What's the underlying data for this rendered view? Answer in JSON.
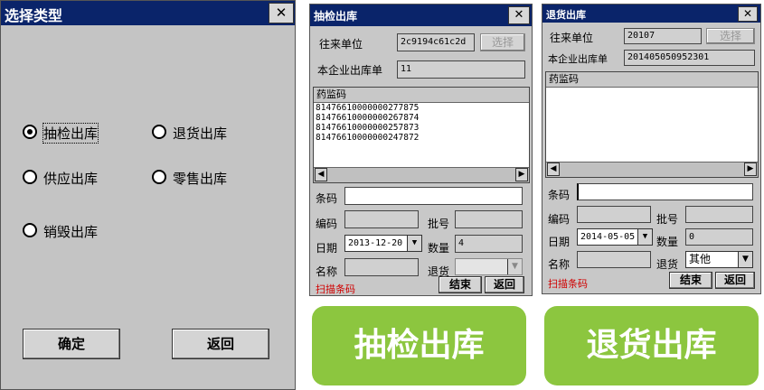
{
  "colors": {
    "title_bar": "#0a246a",
    "panel_bg": "#c8c8c8",
    "green_label": "#8cc63f",
    "scan_text": "#d00000"
  },
  "select_type": {
    "title": "选择类型",
    "close": "✕",
    "options": [
      {
        "label": "抽检出库",
        "selected": true
      },
      {
        "label": "退货出库",
        "selected": false
      },
      {
        "label": "供应出库",
        "selected": false
      },
      {
        "label": "零售出库",
        "selected": false
      },
      {
        "label": "销毁出库",
        "selected": false
      }
    ],
    "ok_label": "确定",
    "back_label": "返回"
  },
  "inspect": {
    "title": "抽检出库",
    "close": "✕",
    "partner_label": "往来单位",
    "partner_value": "2c9194c61c2d",
    "select_label": "选择",
    "order_label": "本企业出库单",
    "order_value": "11",
    "list_header": "药监码",
    "codes": [
      "81476610000000277875",
      "81476610000000267874",
      "81476610000000257873",
      "81476610000000247872"
    ],
    "barcode_label": "条码",
    "barcode_value": "",
    "code_label": "编码",
    "code_value": "",
    "batch_label": "批号",
    "batch_value": "",
    "date_label": "日期",
    "date_value": "2013-12-20",
    "qty_label": "数量",
    "qty_value": "4",
    "name_label": "名称",
    "name_value": "",
    "return_label": "退货",
    "return_value": "",
    "scan_label": "扫描条码",
    "finish_label": "结束",
    "back_label": "返回"
  },
  "returns": {
    "title": "退货出库",
    "close": "✕",
    "partner_label": "往来单位",
    "partner_value": "20107",
    "select_label": "选择",
    "order_label": "本企业出库单",
    "order_value": "201405050952301",
    "list_header": "药监码",
    "codes": [],
    "barcode_label": "条码",
    "barcode_value": "",
    "code_label": "编码",
    "code_value": "",
    "batch_label": "批号",
    "batch_value": "",
    "date_label": "日期",
    "date_value": "2014-05-05",
    "qty_label": "数量",
    "qty_value": "0",
    "name_label": "名称",
    "name_value": "",
    "return_label": "退货",
    "return_value": "其他",
    "scan_label": "扫描条码",
    "finish_label": "结束",
    "back_label": "返回"
  },
  "captions": {
    "inspect": "抽检出库",
    "returns": "退货出库"
  }
}
